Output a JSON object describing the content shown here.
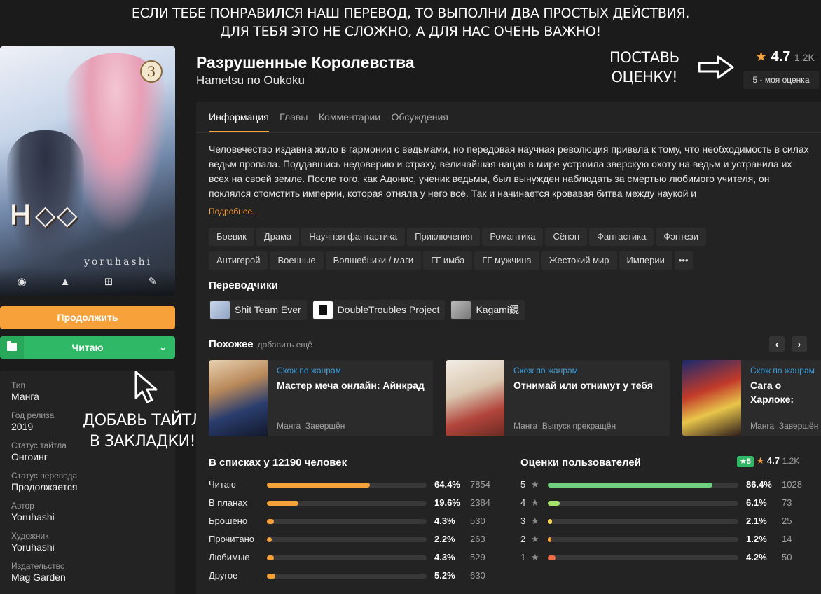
{
  "banner": {
    "line1": "ЕСЛИ ТЕБЕ ПОНРАВИЛСЯ НАШ ПЕРЕВОД, ТО ВЫПОЛНИ ДВА ПРОСТЫХ ДЕЙСТВИЯ.",
    "line2": "ДЛЯ ТЕБЯ ЭТО НЕ СЛОЖНО, А ДЛЯ НАС ОЧЕНЬ ВАЖНО!"
  },
  "cover": {
    "volume": "3",
    "author_art": "yoruhashi",
    "tools": [
      "rss-icon",
      "warning-icon",
      "plus-square-icon",
      "pencil-icon"
    ]
  },
  "buttons": {
    "continue": "Продолжить",
    "reading": "Читаю"
  },
  "info": [
    {
      "label": "Тип",
      "value": "Манга"
    },
    {
      "label": "Год релиза",
      "value": "2019"
    },
    {
      "label": "Статус тайтла",
      "value": "Онгоинг"
    },
    {
      "label": "Статус перевода",
      "value": "Продолжается"
    },
    {
      "label": "Автор",
      "value": "Yoruhashi"
    },
    {
      "label": "Художник",
      "value": "Yoruhashi"
    },
    {
      "label": "Издательство",
      "value": "Mag Garden"
    }
  ],
  "annotations": {
    "bookmark_l1": "ДОБАВЬ ТАЙТЛ",
    "bookmark_l2": "В ЗАКЛАДКИ!",
    "rate_l1": "ПОСТАВЬ",
    "rate_l2": "ОЦЕНКУ!"
  },
  "title": {
    "main": "Разрушенные Королевства",
    "alt": "Hametsu no Oukoku",
    "rating": "4.7",
    "rating_count": "1.2K",
    "my_rating": "5 - моя оценка"
  },
  "tabs": [
    "Информация",
    "Главы",
    "Комментарии",
    "Обсуждения"
  ],
  "description": "Человечество издавна жило в гармонии с ведьмами, но передовая научная революция привела к тому, что необходимость в силах ведьм пропала. Поддавшись недоверию и страху, величайшая нация в мире устроила зверскую охоту на ведьм и устранила их всех на своей земле. После того, как Адонис, ученик ведьмы, был вынужден наблюдать за смертью любимого учителя, он поклялся отомстить империи, которая отняла у него всё. Так и начинается кровавая битва между наукой и",
  "more_label": "Подробнее...",
  "tags": [
    "Боевик",
    "Драма",
    "Научная фантастика",
    "Приключения",
    "Романтика",
    "Сёнэн",
    "Фантастика",
    "Фэнтези",
    "Антигерой",
    "Военные",
    "Волшебники / маги",
    "ГГ имба",
    "ГГ мужчина",
    "Жестокий мир",
    "Империи",
    "•••"
  ],
  "translators_title": "Переводчики",
  "translators": [
    "Shit Team Ever",
    "DoubleTroubles Project",
    "Kagami鏡"
  ],
  "similar": {
    "title": "Похожее",
    "add": "добавить ещё",
    "cards": [
      {
        "cat": "Схож по жанрам",
        "name": "Мастер меча онлайн: Айнкрад",
        "type": "Манга",
        "status": "Завершён"
      },
      {
        "cat": "Схож по жанрам",
        "name": "Отнимай или отнимут у тебя",
        "type": "Манга",
        "status": "Выпуск прекращён"
      },
      {
        "cat": "Схож по жанрам",
        "name": "Сага о Харлоке: Кольцо Нибелунга",
        "type": "Манга",
        "status": "Завершён"
      }
    ]
  },
  "lists": {
    "title": "В списках у 12190 человек",
    "rows": [
      {
        "label": "Читаю",
        "pct": "64.4%",
        "frac": 0.644,
        "count": "7854"
      },
      {
        "label": "В планах",
        "pct": "19.6%",
        "frac": 0.196,
        "count": "2384"
      },
      {
        "label": "Брошено",
        "pct": "4.3%",
        "frac": 0.043,
        "count": "530"
      },
      {
        "label": "Прочитано",
        "pct": "2.2%",
        "frac": 0.022,
        "count": "263"
      },
      {
        "label": "Любимые",
        "pct": "4.3%",
        "frac": 0.043,
        "count": "529"
      },
      {
        "label": "Другое",
        "pct": "5.2%",
        "frac": 0.052,
        "count": "630"
      }
    ]
  },
  "ratings": {
    "title": "Оценки пользователей",
    "my_badge": "5",
    "avg": "4.7",
    "count": "1.2K",
    "rows": [
      {
        "star": "5",
        "pct": "86.4%",
        "frac": 0.864,
        "count": "1028",
        "color": "#6fcf7f"
      },
      {
        "star": "4",
        "pct": "6.1%",
        "frac": 0.061,
        "count": "73",
        "color": "#a6e36a"
      },
      {
        "star": "3",
        "pct": "2.1%",
        "frac": 0.021,
        "count": "25",
        "color": "#f2d34f"
      },
      {
        "star": "2",
        "pct": "1.2%",
        "frac": 0.012,
        "count": "14",
        "color": "#f6a13a"
      },
      {
        "star": "1",
        "pct": "4.2%",
        "frac": 0.042,
        "count": "50",
        "color": "#ef6b4a"
      }
    ]
  },
  "colors": {
    "accent": "#f6a13a",
    "green": "#2fb866",
    "link": "#3a9fe0"
  }
}
